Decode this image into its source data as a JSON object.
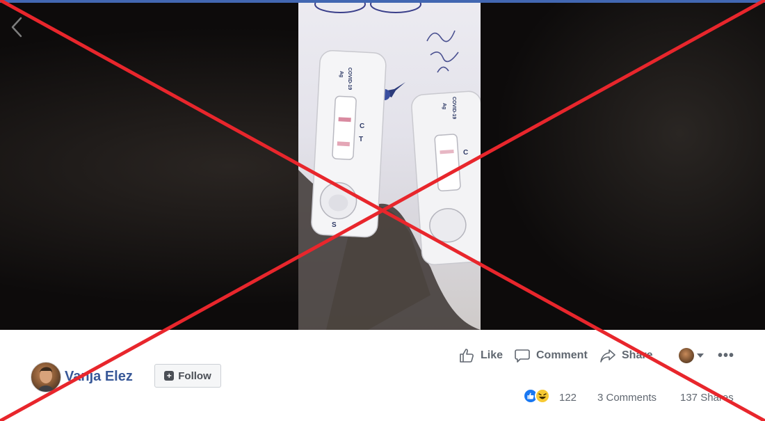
{
  "post": {
    "author": "Vanja Elez",
    "follow_label": "Follow"
  },
  "actions": {
    "like_label": "Like",
    "comment_label": "Comment",
    "share_label": "Share"
  },
  "stats": {
    "reactions_count": "122",
    "comments": "3 Comments",
    "shares": "137 Shares"
  },
  "photo": {
    "test_label": "COVID-19",
    "test_sub": "Ag",
    "mark_c": "C",
    "mark_t": "T",
    "mark_s": "S"
  },
  "colors": {
    "brand": "#4267b2",
    "author_link": "#385898",
    "cross": "#e8262c",
    "like_blue": "#1877f2"
  },
  "icons": [
    "back-arrow-icon",
    "thumbs-up-icon",
    "comment-icon",
    "share-icon",
    "plus-icon",
    "like-reaction-icon",
    "haha-reaction-icon",
    "caret-down-icon",
    "more-icon"
  ]
}
